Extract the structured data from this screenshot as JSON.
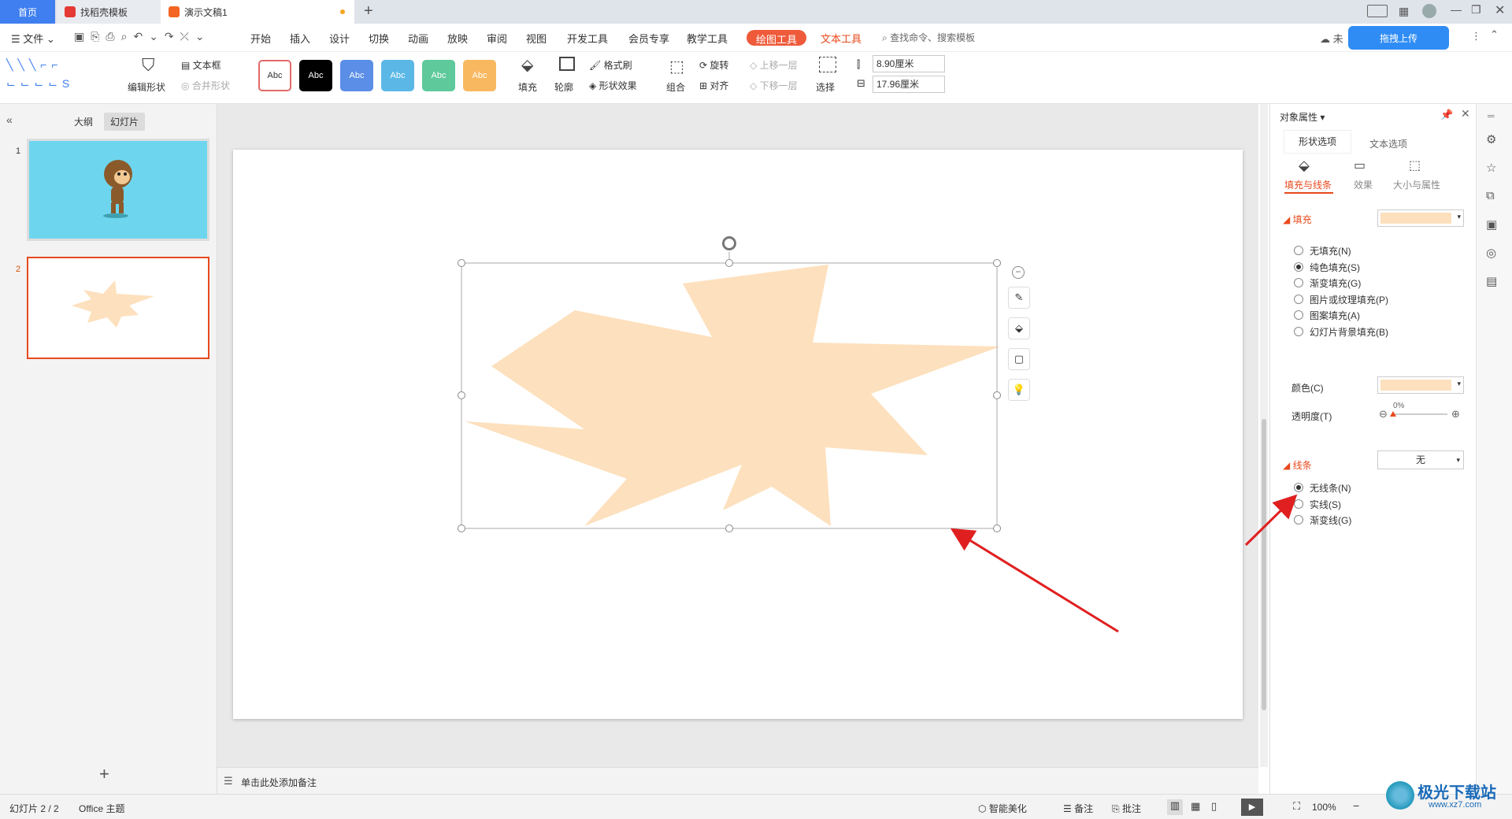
{
  "tabs": {
    "home": "首页",
    "template": "找稻壳模板",
    "doc": "演示文稿1"
  },
  "menu": {
    "file": "文件",
    "items": [
      "开始",
      "插入",
      "设计",
      "切换",
      "动画",
      "放映",
      "审阅",
      "视图",
      "开发工具",
      "会员专享",
      "教学工具"
    ],
    "drawing_tool": "绘图工具",
    "text_tool": "文本工具",
    "search": "查找命令、搜索模板",
    "upload": "拖拽上传",
    "cloud_partial": "未"
  },
  "ribbon": {
    "edit_shape": "编辑形状",
    "textbox": "文本框",
    "merge_shape": "合并形状",
    "style_label": "Abc",
    "fill": "填充",
    "outline": "轮廓",
    "format_painter": "格式刷",
    "shape_effect": "形状效果",
    "rotate": "旋转",
    "align": "对齐",
    "group": "组合",
    "bring_forward": "上移一层",
    "send_backward": "下移一层",
    "select": "选择",
    "height": "8.90厘米",
    "width": "17.96厘米"
  },
  "colors": {
    "accent": "#e8491d",
    "shape_fill": "#fde0bd",
    "thumb1_bg": "#6dd6ee",
    "tab_blue": "#3f7ff0"
  },
  "left": {
    "outline_tab": "大纲",
    "slides_tab": "幻灯片",
    "slide1": "1",
    "slide2": "2"
  },
  "notes": "单击此处添加备注",
  "panel": {
    "title": "对象属性",
    "tab_shape": "形状选项",
    "tab_text": "文本选项",
    "sub_fill_line": "填充与线条",
    "sub_effect": "效果",
    "sub_size": "大小与属性",
    "fill_header": "填充",
    "fill_options": [
      "无填充(N)",
      "纯色填充(S)",
      "渐变填充(G)",
      "图片或纹理填充(P)",
      "图案填充(A)",
      "幻灯片背景填充(B)"
    ],
    "fill_selected": 1,
    "color_label": "颜色(C)",
    "transparency_label": "透明度(T)",
    "transparency_value": "0%",
    "line_header": "线条",
    "line_value": "无",
    "line_options": [
      "无线条(N)",
      "实线(S)",
      "渐变线(G)"
    ],
    "line_selected": 0
  },
  "status": {
    "slide_info": "幻灯片 2 / 2",
    "theme": "Office 主题",
    "smart": "智能美化",
    "notes": "备注",
    "comment": "批注",
    "zoom": "100%"
  },
  "watermark": {
    "text": "极光下载站",
    "url": "www.xz7.com"
  }
}
